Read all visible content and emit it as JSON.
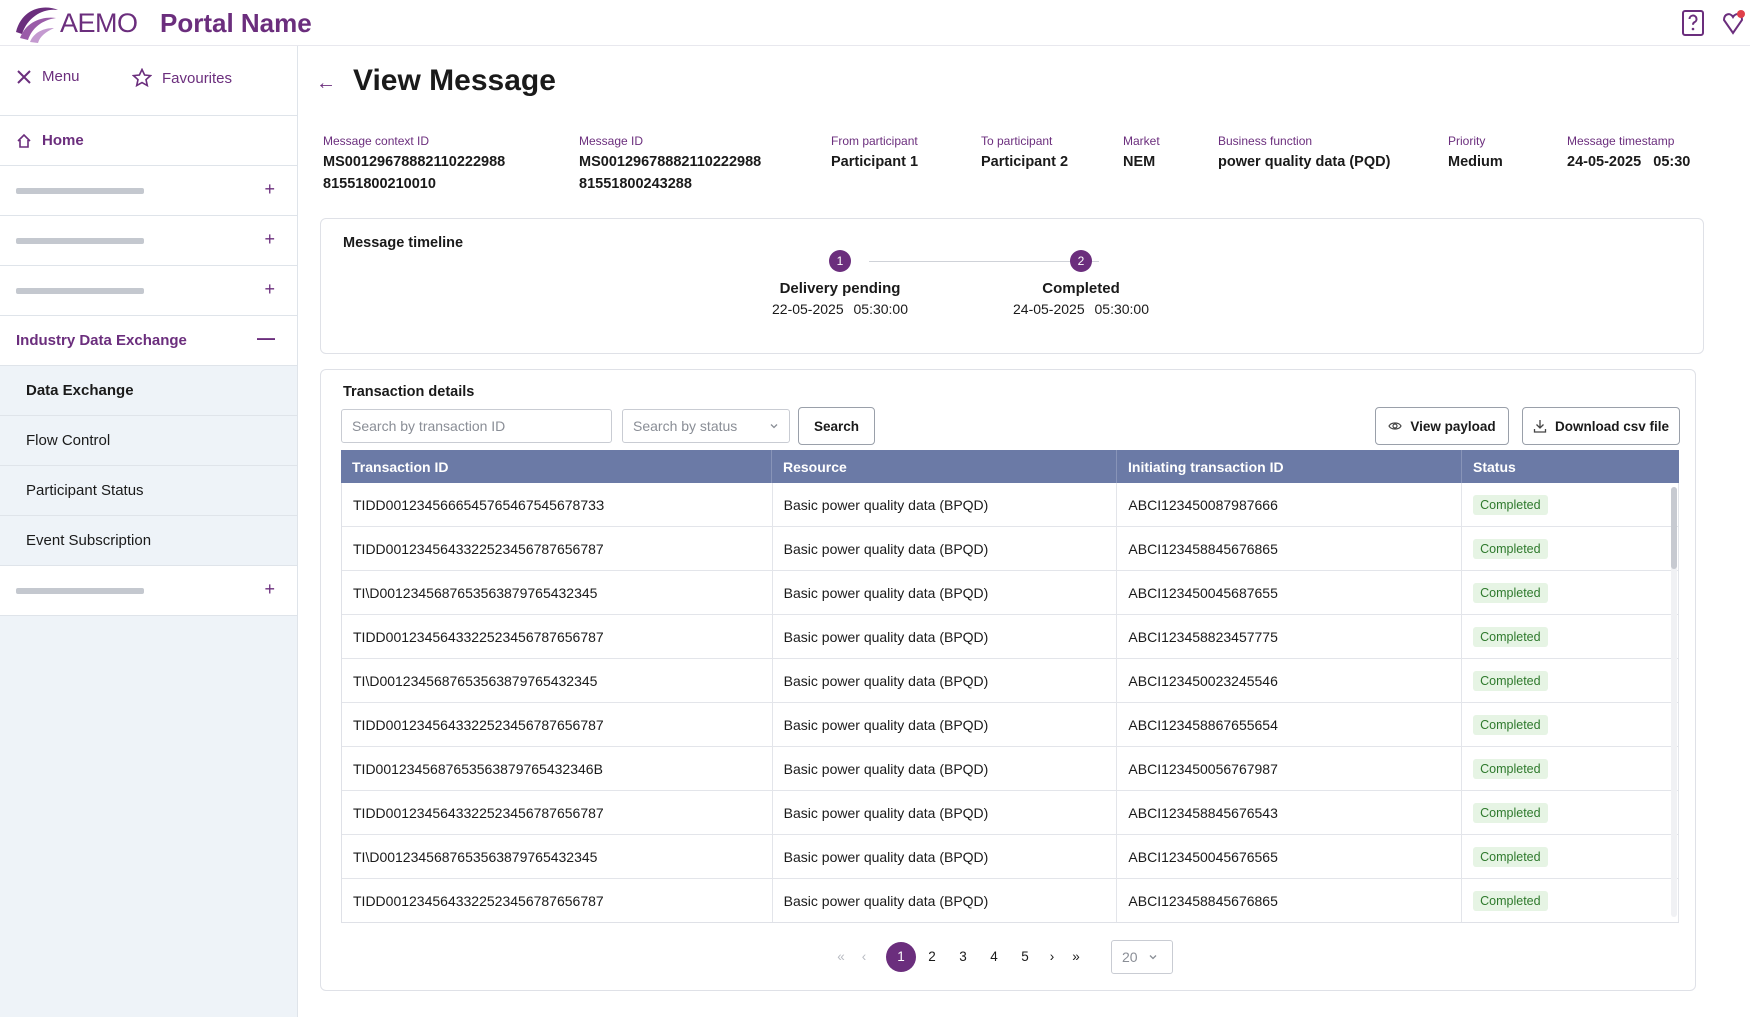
{
  "header": {
    "logo_text": "AEMO",
    "portal_name": "Portal Name",
    "icons": [
      "help-icon",
      "pin-icon"
    ]
  },
  "sidebar": {
    "menu_label": "Menu",
    "favourites_label": "Favourites",
    "home_label": "Home",
    "section_label": "Industry Data Exchange",
    "sub_items": [
      {
        "label": "Data Exchange",
        "active": true
      },
      {
        "label": "Flow Control",
        "active": false
      },
      {
        "label": "Participant Status",
        "active": false
      },
      {
        "label": "Event Subscription",
        "active": false
      }
    ]
  },
  "page": {
    "title": "View Message"
  },
  "message": {
    "context_id_label": "Message context ID",
    "context_id_line1": "MS00129678882110222988",
    "context_id_line2": "81551800210010",
    "message_id_label": "Message ID",
    "message_id_line1": "MS00129678882110222988",
    "message_id_line2": "81551800243288",
    "from_label": "From participant",
    "from_value": "Participant 1",
    "to_label": "To participant",
    "to_value": "Participant 2",
    "market_label": "Market",
    "market_value": "NEM",
    "business_function_label": "Business function",
    "business_function_value": "power quality data (PQD)",
    "priority_label": "Priority",
    "priority_value": "Medium",
    "timestamp_label": "Message timestamp",
    "timestamp_value": "24-05-2025   05:30"
  },
  "timeline": {
    "title": "Message timeline",
    "steps": [
      {
        "number": "1",
        "name": "Delivery pending",
        "time": "22-05-2025 05:30:00"
      },
      {
        "number": "2",
        "name": "Completed",
        "time": "24-05-2025 05:30:00"
      }
    ]
  },
  "transactions": {
    "title": "Transaction details",
    "search_txn_placeholder": "Search by transaction ID",
    "search_status_placeholder": "Search by status",
    "search_button": "Search",
    "view_payload_button": "View payload",
    "download_button": "Download csv file",
    "columns": [
      "Transaction ID",
      "Resource",
      "Initiating transaction ID",
      "Status"
    ],
    "rows": [
      [
        "TIDD001234566654576546754567873З",
        "Basic power quality data (BPQD)",
        "ABCI123450087987666",
        "Completed"
      ],
      [
        "TIDD0012345643322523456787656787",
        "Basic power quality data (BPQD)",
        "ABCI123458845676865",
        "Completed"
      ],
      [
        "TI\\D0012345687653563879765432345",
        "Basic power quality data (BPQD)",
        "ABCI123450045687655",
        "Completed"
      ],
      [
        "TIDD0012345643322523456787656787",
        "Basic power quality data (BPQD)",
        "ABCI123458823457775",
        "Completed"
      ],
      [
        "TI\\D0012345687653563879765432345",
        "Basic power quality data (BPQD)",
        "ABCI123450023245546",
        "Completed"
      ],
      [
        "TIDD0012345643322523456787656787",
        "Basic power quality data (BPQD)",
        "ABCI123458867655654",
        "Completed"
      ],
      [
        "TID0012345687653563879765432346B",
        "Basic power quality data (BPQD)",
        "ABCI123450056767987",
        "Completed"
      ],
      [
        "TIDD0012345643322523456787656787",
        "Basic power quality data (BPQD)",
        "ABCI123458845676543",
        "Completed"
      ],
      [
        "TI\\D0012345687653563879765432345",
        "Basic power quality data (BPQD)",
        "ABCI123450045676565",
        "Completed"
      ],
      [
        "TIDD0012345643322523456787656787",
        "Basic power quality data (BPQD)",
        "ABCI123458845676865",
        "Completed"
      ]
    ]
  },
  "pagination": {
    "first": "«",
    "prev": "‹",
    "pages": [
      "1",
      "2",
      "3",
      "4",
      "5"
    ],
    "current_page": "1",
    "next": "›",
    "last": "»",
    "page_size": "20"
  },
  "colors": {
    "brand": "#6b2e7d",
    "table_header": "#6b7aa6",
    "status_bg": "#e6f4e4",
    "status_text": "#2f7a2d"
  }
}
